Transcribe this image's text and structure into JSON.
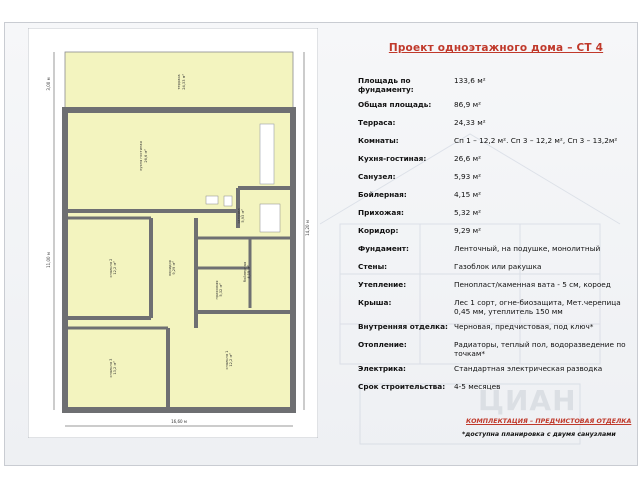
{
  "title": "Проект одноэтажного дома – СТ 4",
  "specs": [
    {
      "label": "Площадь по фундаменту:",
      "value": "133,6 м²"
    },
    {
      "label": "Общая площадь:",
      "value": "86,9 м²"
    },
    {
      "label": "Терраса:",
      "value": "24,33 м²"
    },
    {
      "label": "Комнаты:",
      "value": "Сп 1 – 12,2 м². Сп 3 – 12,2 м², Сп 3 – 13,2м²"
    },
    {
      "label": "Кухня-гостиная:",
      "value": "26,6 м²"
    },
    {
      "label": "Санузел:",
      "value": "5,93 м²"
    },
    {
      "label": "Бойлерная:",
      "value": "4,15 м²"
    },
    {
      "label": "Прихожая:",
      "value": "5,32 м²"
    },
    {
      "label": "Коридор:",
      "value": "9,29 м²"
    },
    {
      "label": "Фундамент:",
      "value": "Ленточный, на подушке, монолитный"
    },
    {
      "label": "Стены:",
      "value": "Газоблок или ракушка"
    },
    {
      "label": "Утепление:",
      "value": "Пенопласт/каменная вата - 5 см, короед"
    },
    {
      "label": "Крыша:",
      "value": "Лес 1 сорт, огне-биозащита, Мет.черепица 0,45 мм, утеплитель 150 мм"
    },
    {
      "label": "Внутренняя отделка:",
      "value": "Черновая, предчистовая, под ключ*"
    },
    {
      "label": "Отопление:",
      "value": "Радиаторы, теплый пол, водоразведение по точкам*"
    },
    {
      "label": "Электрика:",
      "value": "Стандартная электрическая разводка"
    },
    {
      "label": "Срок строительства:",
      "value": "4-5 месяцев"
    }
  ],
  "note_complect": "КОМПЛЕКТАЦИЯ – ПРЕДЧИСТОВАЯ ОТДЕЛКА",
  "note_plan": "*доступна планировка с двумя санузлами",
  "plan": {
    "terrace": {
      "name": "терраса",
      "area": "24,33 м²"
    },
    "kitchen": {
      "name": "кухня гостиная",
      "area": "26,6 м²"
    },
    "bathroom": {
      "name": "санузел",
      "area": "5,93 м²"
    },
    "boiler": {
      "name": "бойлерная",
      "area": "4,15 м²"
    },
    "hall": {
      "name": "прихожая",
      "area": "5,32 м²"
    },
    "corridor": {
      "name": "коридор",
      "area": "9,29 м²"
    },
    "bed2": {
      "name": "спальня 2",
      "area": "12,2 м²"
    },
    "bed3": {
      "name": "спальня 3",
      "area": "13,2 м²"
    },
    "bed1": {
      "name": "спальня 1",
      "area": "12,2 м²"
    },
    "dims": {
      "left_top": "3,00 м",
      "left_main": "11,00 м",
      "right": "14,20 м",
      "bottom": "16,60 м"
    }
  },
  "colors": {
    "room": "#f3f4bf",
    "wall": "#6e6f72",
    "title": "#c0392b"
  }
}
